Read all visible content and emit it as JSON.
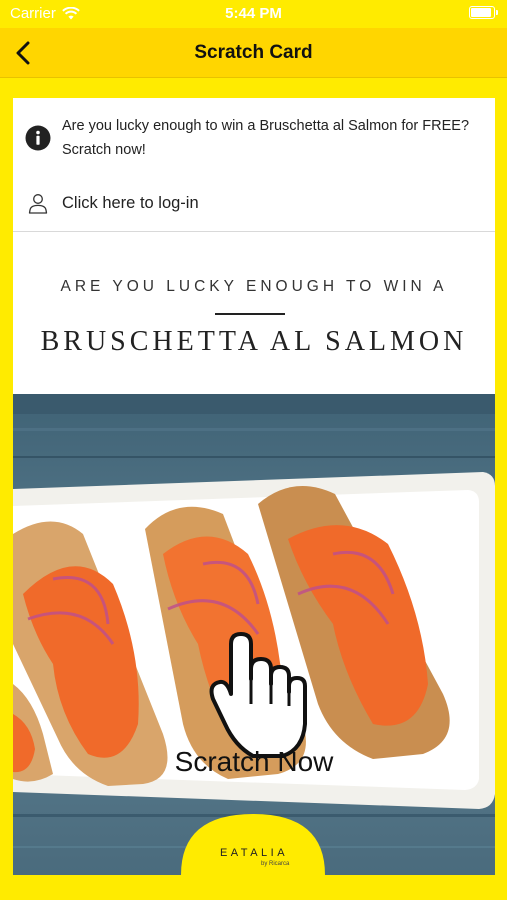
{
  "status_bar": {
    "carrier": "Carrier",
    "time": "5:44 PM"
  },
  "nav": {
    "title": "Scratch Card"
  },
  "info": {
    "text": "Are you lucky enough to win a Bruschetta al Salmon for FREE? Scratch now!"
  },
  "login": {
    "label": "Click here to log-in"
  },
  "promo": {
    "tagline": "ARE YOU LUCKY ENOUGH TO WIN A",
    "dish": "BRUSCHETTA AL SALMON"
  },
  "scratch": {
    "label": "Scratch Now"
  },
  "logo": {
    "name": "EATALIA",
    "sub": "by Ricarca"
  },
  "colors": {
    "background": "#FFEB00",
    "nav": "#FFD600",
    "salmon": "#F06A2A"
  }
}
